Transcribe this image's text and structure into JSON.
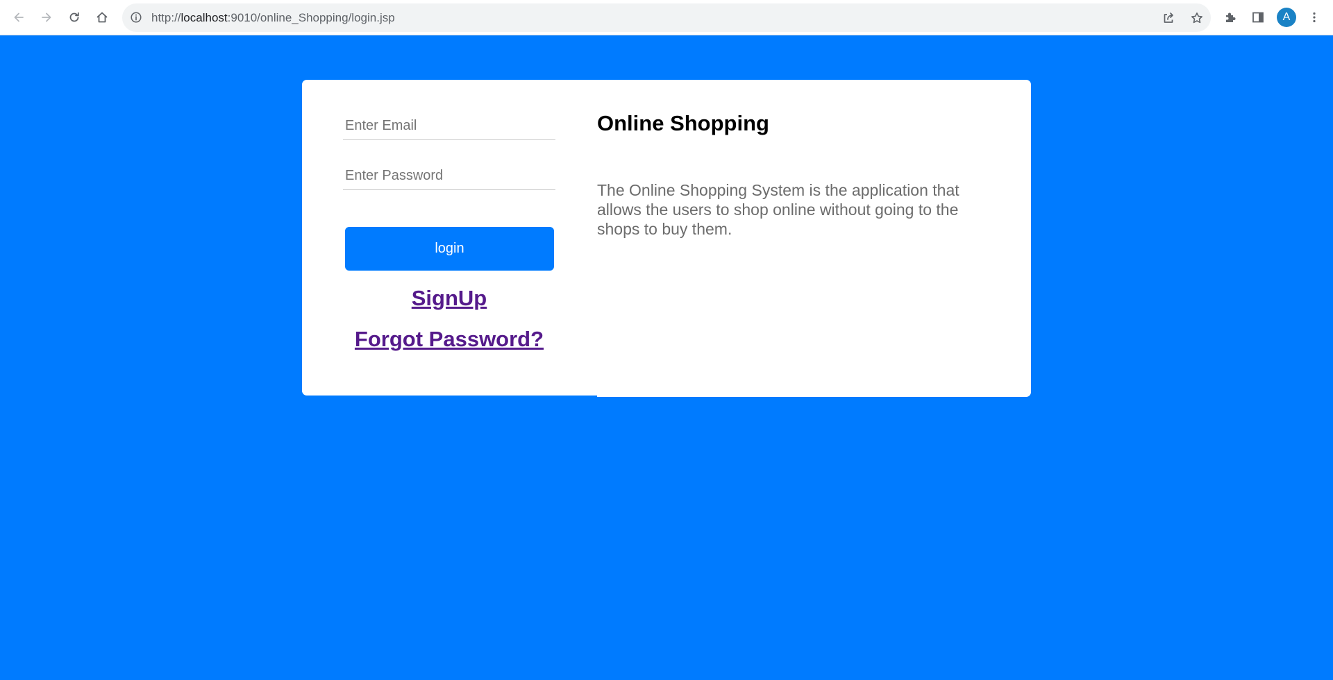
{
  "browser": {
    "url_prefix": "http://",
    "url_host": "localhost",
    "url_path": ":9010/online_Shopping/login.jsp",
    "profile_initial": "A",
    "icons": [
      "back-icon",
      "forward-icon",
      "reload-icon",
      "home-icon",
      "info-icon",
      "share-icon",
      "star-icon",
      "extensions-icon",
      "side-panel-icon",
      "menu-icon"
    ]
  },
  "login": {
    "email_placeholder": "Enter Email",
    "password_placeholder": "Enter Password",
    "login_label": "login",
    "signup_label": "SignUp",
    "forgot_label": "Forgot Password?"
  },
  "info": {
    "title": "Online Shopping",
    "description": "The Online Shopping System is the application that allows the users to shop online without going to the shops to buy them."
  },
  "colors": {
    "page_background": "#007bff",
    "button": "#007bff",
    "link": "#551a8b",
    "avatar": "#1a82c5"
  }
}
